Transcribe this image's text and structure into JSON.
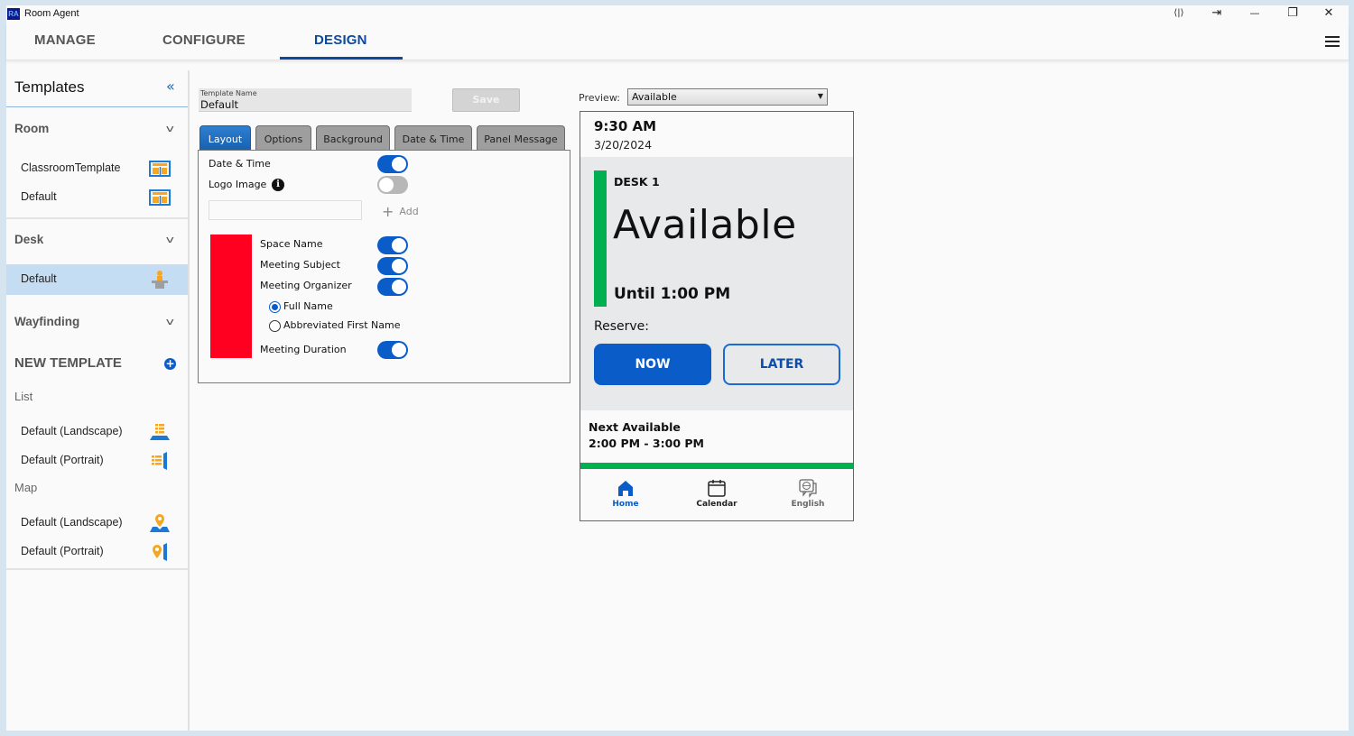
{
  "app": {
    "title": "Room Agent",
    "logo_text": "RA"
  },
  "window_controls": {
    "dock": "⟨|⟩",
    "exit": "⇥",
    "minimize": "—",
    "restore": "❐",
    "close": "✕"
  },
  "nav": {
    "tabs": [
      {
        "label": "MANAGE",
        "active": false
      },
      {
        "label": "CONFIGURE",
        "active": false
      },
      {
        "label": "DESIGN",
        "active": true
      }
    ]
  },
  "sidebar": {
    "title": "Templates",
    "collapse_icon": "«",
    "sections": [
      {
        "label": "Room",
        "items": [
          {
            "label": "ClassroomTemplate",
            "icon": "room-layout-icon"
          },
          {
            "label": "Default",
            "icon": "room-layout-icon"
          }
        ]
      },
      {
        "label": "Desk",
        "items": [
          {
            "label": "Default",
            "icon": "desk-person-icon",
            "selected": true
          }
        ]
      },
      {
        "label": "Wayfinding",
        "items": []
      }
    ],
    "new_template": {
      "label": "NEW TEMPLATE",
      "plus": "+",
      "groups": [
        {
          "label": "List",
          "items": [
            {
              "label": "Default (Landscape)",
              "icon": "list-landscape-icon"
            },
            {
              "label": "Default (Portrait)",
              "icon": "list-portrait-icon"
            }
          ]
        },
        {
          "label": "Map",
          "items": [
            {
              "label": "Default (Landscape)",
              "icon": "map-landscape-icon"
            },
            {
              "label": "Default (Portrait)",
              "icon": "map-portrait-icon"
            }
          ]
        }
      ]
    }
  },
  "editor": {
    "template_name_label": "Template Name",
    "template_name_value": "Default",
    "save_label": "Save",
    "tabs": [
      {
        "label": "Layout",
        "active": true
      },
      {
        "label": "Options",
        "active": false
      },
      {
        "label": "Background",
        "active": false
      },
      {
        "label": "Date & Time",
        "active": false
      },
      {
        "label": "Panel Message",
        "active": false
      }
    ],
    "layout": {
      "date_time": {
        "label": "Date & Time",
        "on": true
      },
      "logo_image": {
        "label": "Logo Image",
        "on": false,
        "info": "i"
      },
      "logo_input_value": "",
      "add_label": "Add",
      "add_plus": "+",
      "status_color": "#ff0020",
      "space_name": {
        "label": "Space Name",
        "on": true
      },
      "meeting_subject": {
        "label": "Meeting Subject",
        "on": true
      },
      "meeting_organizer": {
        "label": "Meeting Organizer",
        "on": true
      },
      "organizer_options": [
        {
          "label": "Full Name",
          "checked": true
        },
        {
          "label": "Abbreviated First Name",
          "checked": false
        }
      ],
      "meeting_duration": {
        "label": "Meeting Duration",
        "on": true
      }
    }
  },
  "preview": {
    "label": "Preview:",
    "selected": "Available",
    "arrow": "▼",
    "device": {
      "time": "9:30 AM",
      "date": "3/20/2024",
      "space": "DESK 1",
      "status": "Available",
      "until": "Until 1:00 PM",
      "reserve_label": "Reserve:",
      "now_label": "NOW",
      "later_label": "LATER",
      "next_label": "Next Available",
      "next_time": "2:00 PM - 3:00 PM",
      "status_color": "#00b050",
      "nav": [
        {
          "label": "Home",
          "icon": "home-icon",
          "color": "#0a5cc9"
        },
        {
          "label": "Calendar",
          "icon": "calendar-icon",
          "color": "#222222"
        },
        {
          "label": "English",
          "icon": "language-globe-icon",
          "color": "#666666"
        }
      ]
    }
  }
}
